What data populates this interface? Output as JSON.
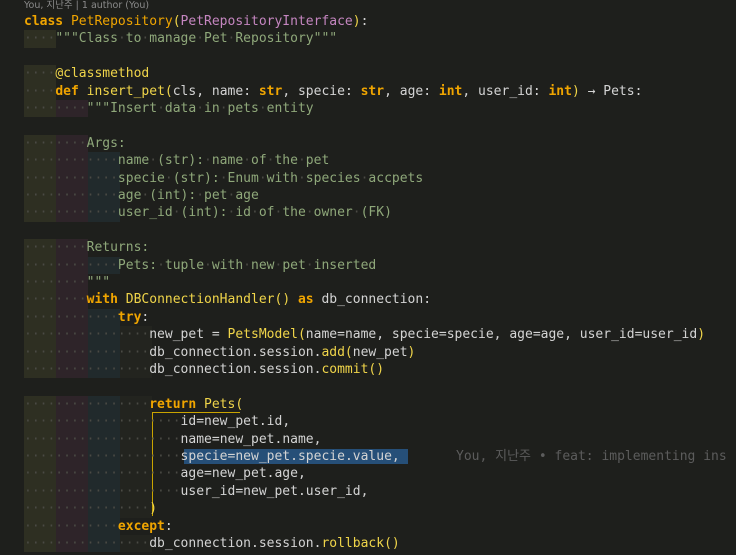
{
  "codelens": {
    "text": "You, 지난주 | 1 author (You)"
  },
  "blame": {
    "text": "You, 지난주 • feat: implementing ins"
  },
  "lines": [
    {
      "text": "class PetRepository(PetRepositoryInterface):"
    },
    {
      "text": "    \"\"\"Class to manage Pet Repository\"\"\""
    },
    {
      "text": ""
    },
    {
      "text": "    @classmethod"
    },
    {
      "text": "    def insert_pet(cls, name: str, specie: str, age: int, user_id: int) → Pets:"
    },
    {
      "text": "        \"\"\"Insert data in pets entity"
    },
    {
      "text": ""
    },
    {
      "text": "        Args:"
    },
    {
      "text": "            name (str): name of the pet"
    },
    {
      "text": "            specie (str): Enum with species accpets"
    },
    {
      "text": "            age (int): pet age"
    },
    {
      "text": "            user_id (int): id of the owner (FK)"
    },
    {
      "text": ""
    },
    {
      "text": "        Returns:"
    },
    {
      "text": "            Pets: tuple with new pet inserted"
    },
    {
      "text": "        \"\"\""
    },
    {
      "text": "        with DBConnectionHandler() as db_connection:"
    },
    {
      "text": "            try:"
    },
    {
      "text": "                new_pet = PetsModel(name=name, specie=specie, age=age, user_id=user_id)"
    },
    {
      "text": "                db_connection.session.add(new_pet)"
    },
    {
      "text": "                db_connection.session.commit()"
    },
    {
      "text": ""
    },
    {
      "text": "                return Pets("
    },
    {
      "text": "                    id=new_pet.id,"
    },
    {
      "text": "                    name=new_pet.name,"
    },
    {
      "text": "                    specie=new_pet.specie.value,"
    },
    {
      "text": "                    age=new_pet.age,"
    },
    {
      "text": "                    user_id=new_pet.user_id,"
    },
    {
      "text": "                )"
    },
    {
      "text": "            except:"
    },
    {
      "text": "                db_connection.session.rollback()"
    }
  ],
  "colors": {
    "background": "#1e1f1c",
    "keyword": "#f0a500",
    "function": "#f0d54a",
    "string": "#8fa87a",
    "selection": "#264f78"
  }
}
